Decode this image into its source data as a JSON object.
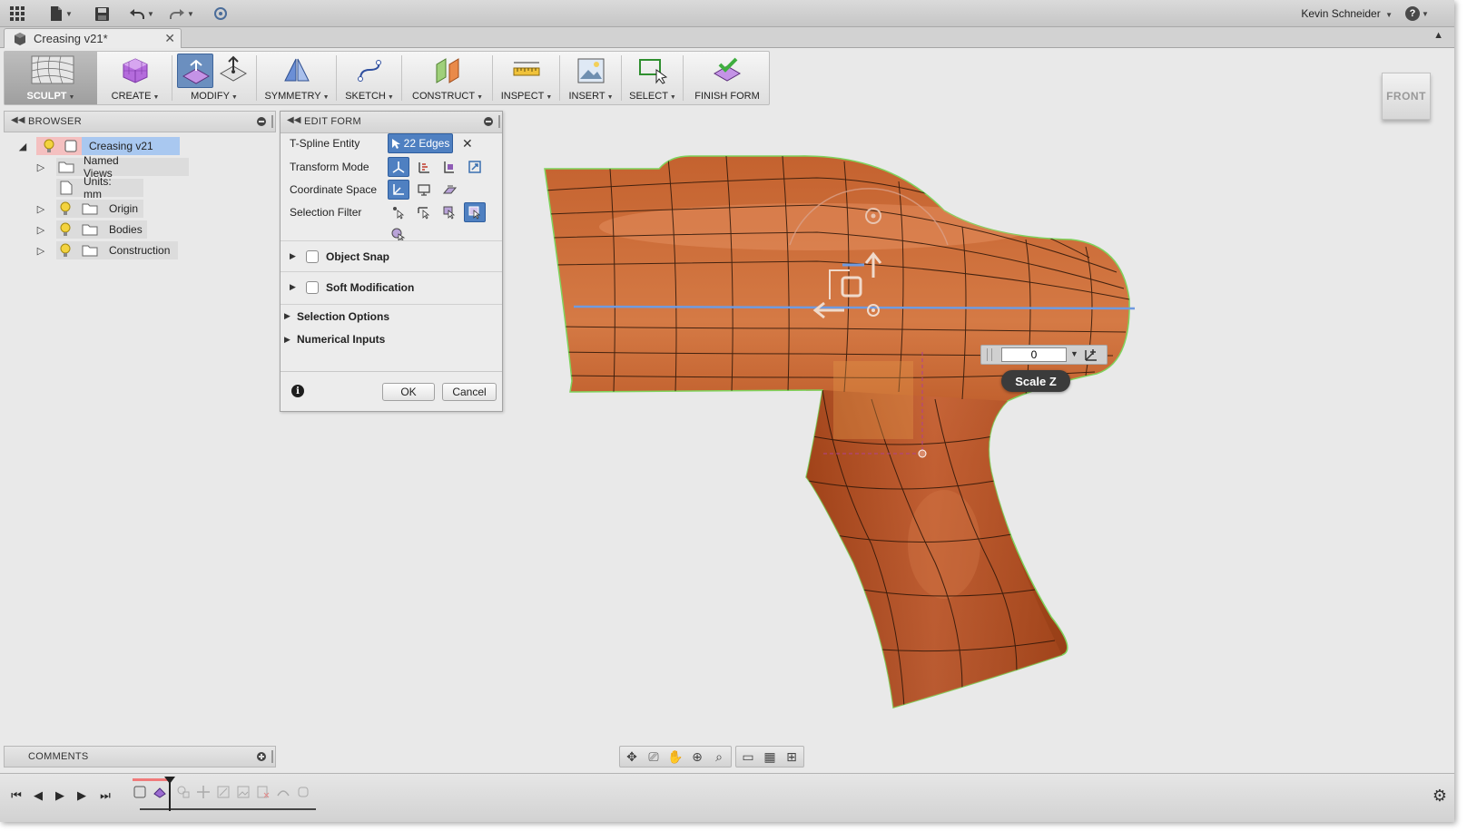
{
  "window": {
    "user_name": "Kevin Schneider"
  },
  "document_tab": {
    "title": "Creasing v21*"
  },
  "ribbon": {
    "workspace_label": "SCULPT",
    "groups": [
      {
        "label": "CREATE"
      },
      {
        "label": "MODIFY"
      },
      {
        "label": "SYMMETRY"
      },
      {
        "label": "SKETCH"
      },
      {
        "label": "CONSTRUCT"
      },
      {
        "label": "INSPECT"
      },
      {
        "label": "INSERT"
      },
      {
        "label": "SELECT"
      },
      {
        "label": "FINISH FORM"
      }
    ]
  },
  "browser": {
    "title": "BROWSER",
    "root": "Creasing v21",
    "items": [
      {
        "label": "Named Views"
      },
      {
        "label": "Units: mm"
      },
      {
        "label": "Origin"
      },
      {
        "label": "Bodies"
      },
      {
        "label": "Construction"
      }
    ]
  },
  "edit_form": {
    "title": "EDIT FORM",
    "tspline_entity_label": "T-Spline Entity",
    "tspline_selection": "22 Edges",
    "transform_mode_label": "Transform Mode",
    "coordinate_space_label": "Coordinate Space",
    "selection_filter_label": "Selection Filter",
    "sections": {
      "object_snap": "Object Snap",
      "soft_modification": "Soft Modification",
      "selection_options": "Selection Options",
      "numerical_inputs": "Numerical Inputs"
    },
    "ok_label": "OK",
    "cancel_label": "Cancel",
    "info_glyph": "i"
  },
  "viewcube": {
    "face_label": "FRONT"
  },
  "manipulator_input": {
    "value": "0",
    "tooltip": "Scale Z"
  },
  "comments": {
    "title": "COMMENTS"
  },
  "colors": {
    "model_fill": "#b8502a",
    "model_edge": "#7fd35c",
    "selection_blue": "#4f80c1",
    "crease_line": "#6f9be0"
  }
}
